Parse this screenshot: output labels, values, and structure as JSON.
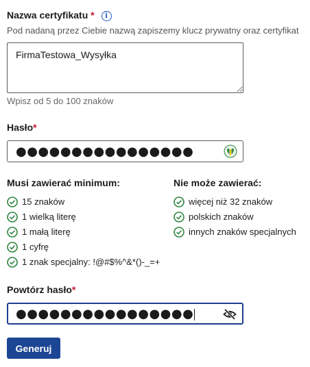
{
  "certificate": {
    "label": "Nazwa certyfikatu",
    "required_mark": "*",
    "info_icon": "info-icon",
    "description": "Pod nadaną przez Ciebie nazwą zapiszemy klucz prywatny oraz certyfikat",
    "value": "FirmaTestowa_Wysyłka",
    "hint": "Wpisz od 5 do 100 znaków"
  },
  "password": {
    "label": "Hasło",
    "required_mark": "*",
    "masked_value": "●●●●●●●●●●●●●●●●",
    "toggle_icon": "show-password-icon"
  },
  "rules": {
    "must_title": "Musi zawierać minimum:",
    "must_items": [
      "15 znaków",
      "1 wielką literę",
      "1 małą literę",
      "1 cyfrę",
      "1 znak specjalny: !@#$%^&*()-_=+"
    ],
    "cannot_title": "Nie może zawierać:",
    "cannot_items": [
      "więcej niż 32 znaków",
      "polskich znaków",
      "innych znaków specjalnych"
    ],
    "check_color": "#2e8540"
  },
  "repeat_password": {
    "label": "Powtórz hasło",
    "required_mark": "*",
    "masked_value": "●●●●●●●●●●●●●●●●",
    "toggle_icon": "hide-password-icon"
  },
  "actions": {
    "generate_label": "Generuj"
  },
  "colors": {
    "accent": "#1c4694",
    "required": "#c0132f",
    "success": "#2e8540"
  }
}
